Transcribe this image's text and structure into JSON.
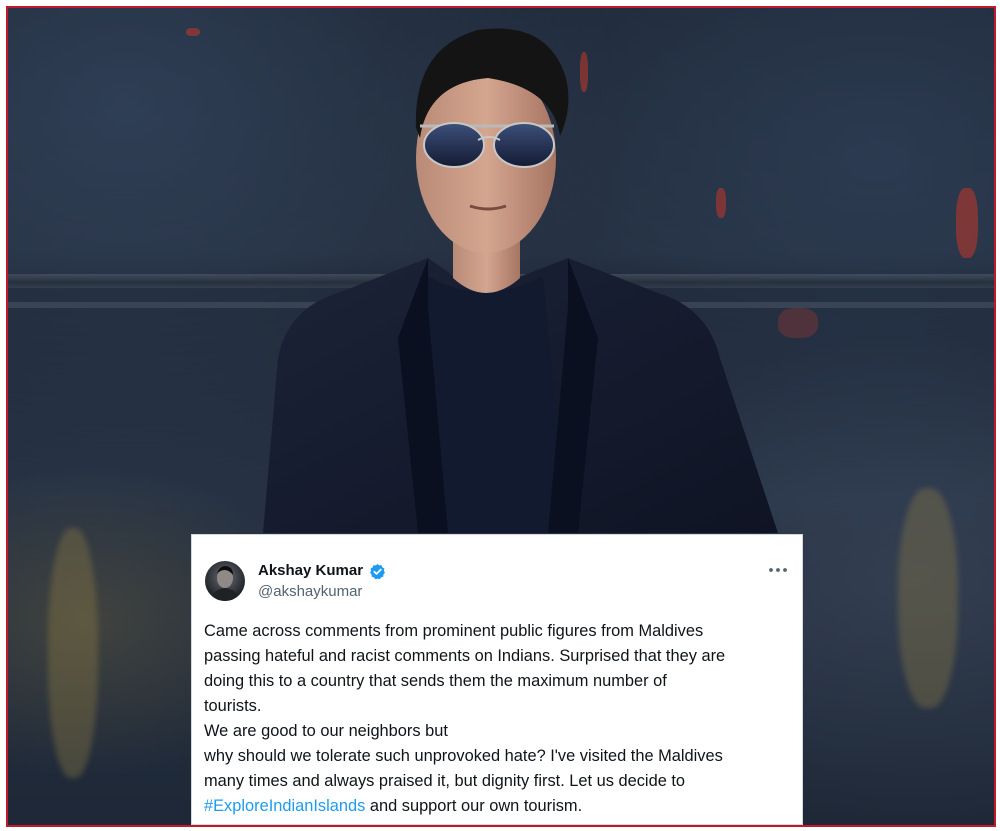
{
  "colors": {
    "frame_border": "#c2182c",
    "card_background": "#ffffff",
    "text_primary": "#0f1419",
    "text_secondary": "#536471",
    "hashtag": "#1d9bf0",
    "verified_badge": "#1d9bf0"
  },
  "tweet": {
    "author": {
      "display_name": "Akshay Kumar",
      "handle": "@akshaykumar",
      "verified_icon": "verified-badge-icon",
      "avatar_icon": "avatar"
    },
    "more_icon": "more-options-icon",
    "body": {
      "line1": "Came across comments from prominent public figures from Maldives",
      "line2": "passing hateful and racist comments on Indians. Surprised that they are",
      "line3": "doing this to a country that sends them the maximum number of",
      "line4": "tourists.",
      "line5": "We are good to our neighbors but",
      "line6": "why should we tolerate such unprovoked hate? I've visited the Maldives",
      "line7": "many times and always praised it, but dignity first. Let us decide to",
      "hashtag": "#ExploreIndianIslands",
      "line8_rest": " and support our own tourism."
    }
  }
}
